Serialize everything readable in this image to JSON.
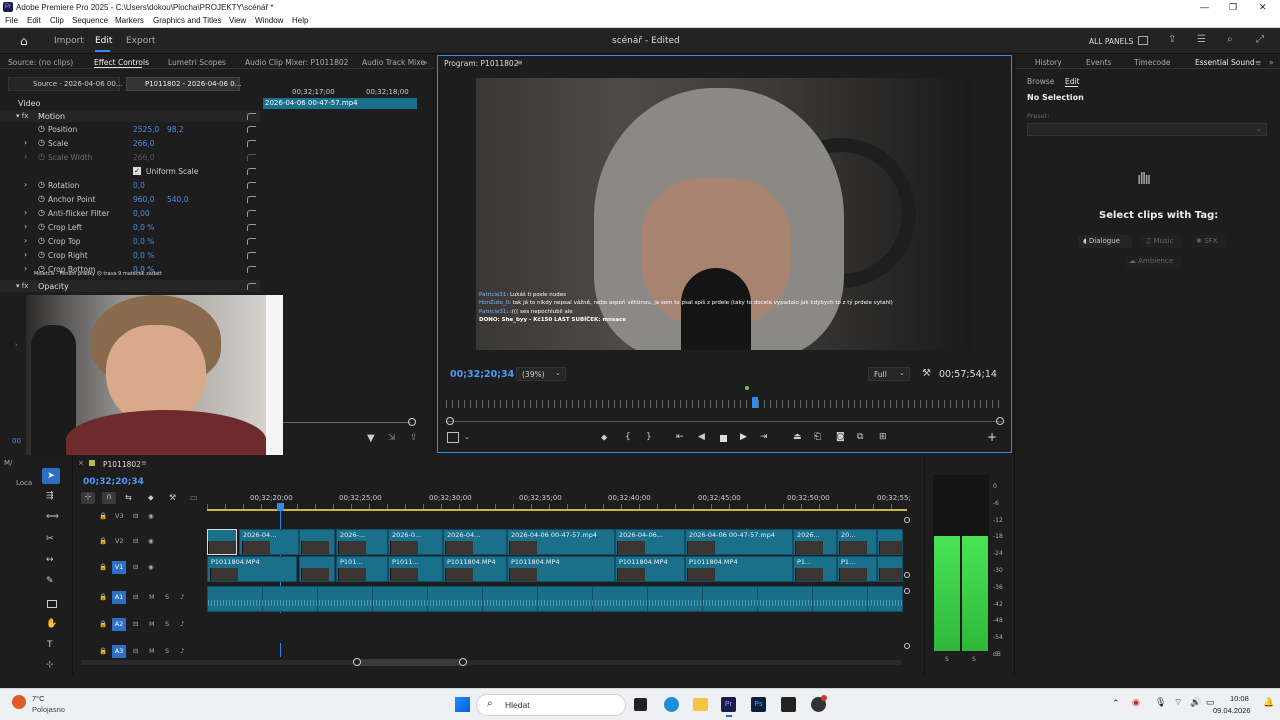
{
  "window": {
    "title": "Adobe Premiere Pro 2025 - C:\\Users\\dokou\\Plocha\\PROJEKTY\\scénář *"
  },
  "menu": [
    "File",
    "Edit",
    "Clip",
    "Sequence",
    "Markers",
    "Graphics and Titles",
    "View",
    "Window",
    "Help"
  ],
  "header": {
    "nav": [
      "Import",
      "Edit",
      "Export"
    ],
    "active": "Edit",
    "project": "scénář - Edited",
    "all_panels": "ALL PANELS"
  },
  "left_panel": {
    "tabs": [
      "Source: (no clips)",
      "Effect Controls",
      "Lumetri Scopes",
      "Audio Clip Mixer: P1011802",
      "Audio Track Mixe"
    ],
    "subtabs": [
      "Source - 2026-04-06 00...",
      "P1011802 - 2026-04-06 0..."
    ],
    "ruler": [
      "00;32;17;00",
      "00;32;18;00"
    ],
    "clip_name": "2026-04-06 00-47-57.mp4",
    "video_label": "Video",
    "motion": "Motion",
    "params": [
      {
        "name": "Position",
        "v1": "2525,0",
        "v2": "98,2"
      },
      {
        "name": "Scale",
        "v1": "266,0",
        "v2": ""
      },
      {
        "name": "Scale Width",
        "v1": "266,0",
        "v2": ""
      },
      {
        "name": "Uniform Scale",
        "v1": "",
        "v2": ""
      },
      {
        "name": "Rotation",
        "v1": "0,0",
        "v2": ""
      },
      {
        "name": "Anchor Point",
        "v1": "960,0",
        "v2": "540,0"
      },
      {
        "name": "Anti-flicker Filter",
        "v1": "0,00",
        "v2": ""
      },
      {
        "name": "Crop Left",
        "v1": "0,0 %",
        "v2": ""
      },
      {
        "name": "Crop Top",
        "v1": "0,0 %",
        "v2": ""
      },
      {
        "name": "Crop Right",
        "v1": "0,0 %",
        "v2": ""
      },
      {
        "name": "Crop Bottom",
        "v1": "0,0 %",
        "v2": ""
      }
    ],
    "opacity": "Opacity",
    "bottom_tc": "00"
  },
  "program": {
    "title": "Program: P1011802",
    "timecode": "00;32;20;34",
    "zoom": "(39%)",
    "quality": "Full",
    "duration": "00;57;54;14",
    "chat": [
      {
        "user": "Patricie31",
        "msg": "Lukáš ti posle nudes"
      },
      {
        "user": "HonZuto_0",
        "msg": "tak já to nikdy nepsal vážně, nebo aspoň většinou, ja sem to psal spíš z prdele (taky to docela vypadalo jak kdybych to z tý prdele vytahl)"
      },
      {
        "user": "Patricie31",
        "msg": ":((( ses nepochlubil ale"
      }
    ],
    "donation": "DONO: She_byy - Kč150   LAST SUBÍČEK: mnsace",
    "overlay_text": "Moletcis - Fenom pradky ☹ trava 9 mateček zadatt"
  },
  "right_panel": {
    "tabs": [
      "History",
      "Events",
      "Timecode",
      "Essential Sound"
    ],
    "subtabs": [
      "Browse",
      "Edit"
    ],
    "selection": "No Selection",
    "preset_label": "Preset:",
    "tag_title": "Select clips with Tag:",
    "tags": [
      "Dialogue",
      "Music",
      "SFX",
      "Ambience"
    ]
  },
  "timeline": {
    "sequence": "P1011802",
    "timecode": "00;32;20;34",
    "ruler": [
      "00;32;20;00",
      "00;32;25;00",
      "00;32;30;00",
      "00;32;35;00",
      "00;32;40;00",
      "00;32;45;00",
      "00;32;50;00",
      "00;32;55;"
    ],
    "tracks": [
      "V3",
      "V2",
      "V1",
      "A1",
      "A2",
      "A3"
    ],
    "v2_clips": [
      "",
      "2026-04...",
      "2026-...",
      "2026-0...",
      "2026-04...",
      "2026-04-06 00-47-57.mp4",
      "2026-04-06...",
      "2026-04-06 00-47-57.mp4",
      "2026...",
      "20..."
    ],
    "v1_clips": [
      "P1011804.MP4",
      "P101...",
      "P1011...",
      "P1011804.MP4",
      "P1011804.MP4",
      "P1011804.MP4",
      "P1011804.MP4",
      "P1...",
      "P1..."
    ],
    "locs": "Loca"
  },
  "meter": {
    "scale": [
      "0",
      "-6",
      "-12",
      "-18",
      "-24",
      "-30",
      "-36",
      "-42",
      "-48",
      "-54",
      "dB"
    ],
    "channels": [
      "S",
      "S"
    ],
    "level": -23
  },
  "taskbar": {
    "weather_temp": "7°C",
    "weather_desc": "Polojasno",
    "search": "Hledat",
    "time": "10:08",
    "date": "09.04.2026"
  },
  "colors": {
    "accent": "#2d8ceb",
    "clip_video": "#1a6f8b",
    "clip_audio": "#1b6e88",
    "meter": "#3ddc4a"
  }
}
